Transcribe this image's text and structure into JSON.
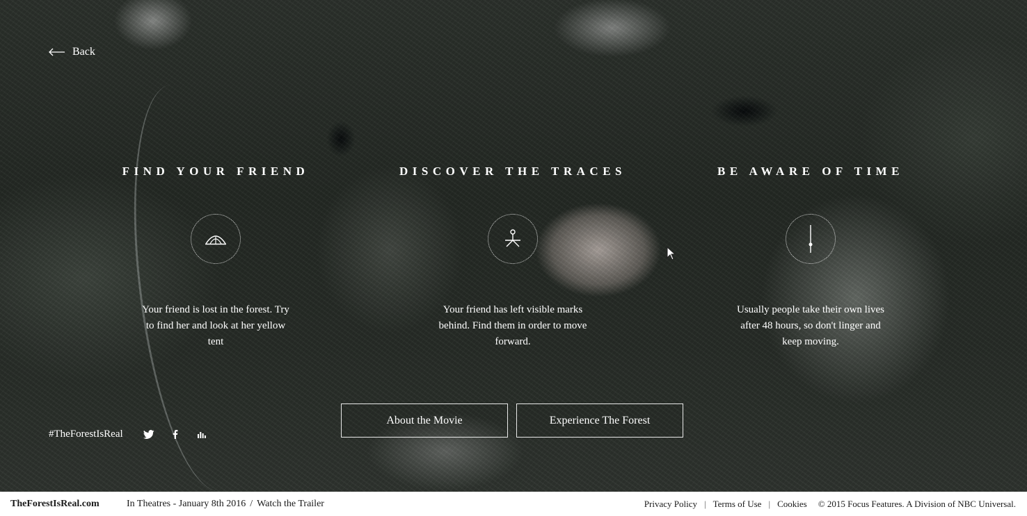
{
  "nav": {
    "back_label": "Back"
  },
  "columns": [
    {
      "title": "FIND YOUR FRIEND",
      "icon": "tent-icon",
      "text": "Your friend is lost in the forest. Try to find her and look at her yellow tent"
    },
    {
      "title": "DISCOVER THE TRACES",
      "icon": "traces-icon",
      "text": "Your friend has left visible marks behind. Find them in order to move forward."
    },
    {
      "title": "BE AWARE OF TIME",
      "icon": "time-icon",
      "text": "Usually people take their own lives after 48 hours, so don't linger and keep moving."
    }
  ],
  "buttons": {
    "about": "About the Movie",
    "experience": "Experience The Forest"
  },
  "social": {
    "hashtag": "#TheForestIsReal",
    "icons": [
      "twitter-icon",
      "facebook-icon",
      "stats-icon"
    ]
  },
  "footer": {
    "site": "TheForestIsReal.com",
    "release": "In Theatres - January 8th 2016",
    "separator": "/",
    "trailer": "Watch the Trailer",
    "privacy": "Privacy Policy",
    "terms": "Terms of Use",
    "cookies": "Cookies",
    "copyright": "© 2015 Focus Features. A Division of NBC Universal."
  },
  "colors": {
    "text": "#ffffff",
    "footer_bg": "#ffffff",
    "footer_text": "#1a1a1a"
  }
}
